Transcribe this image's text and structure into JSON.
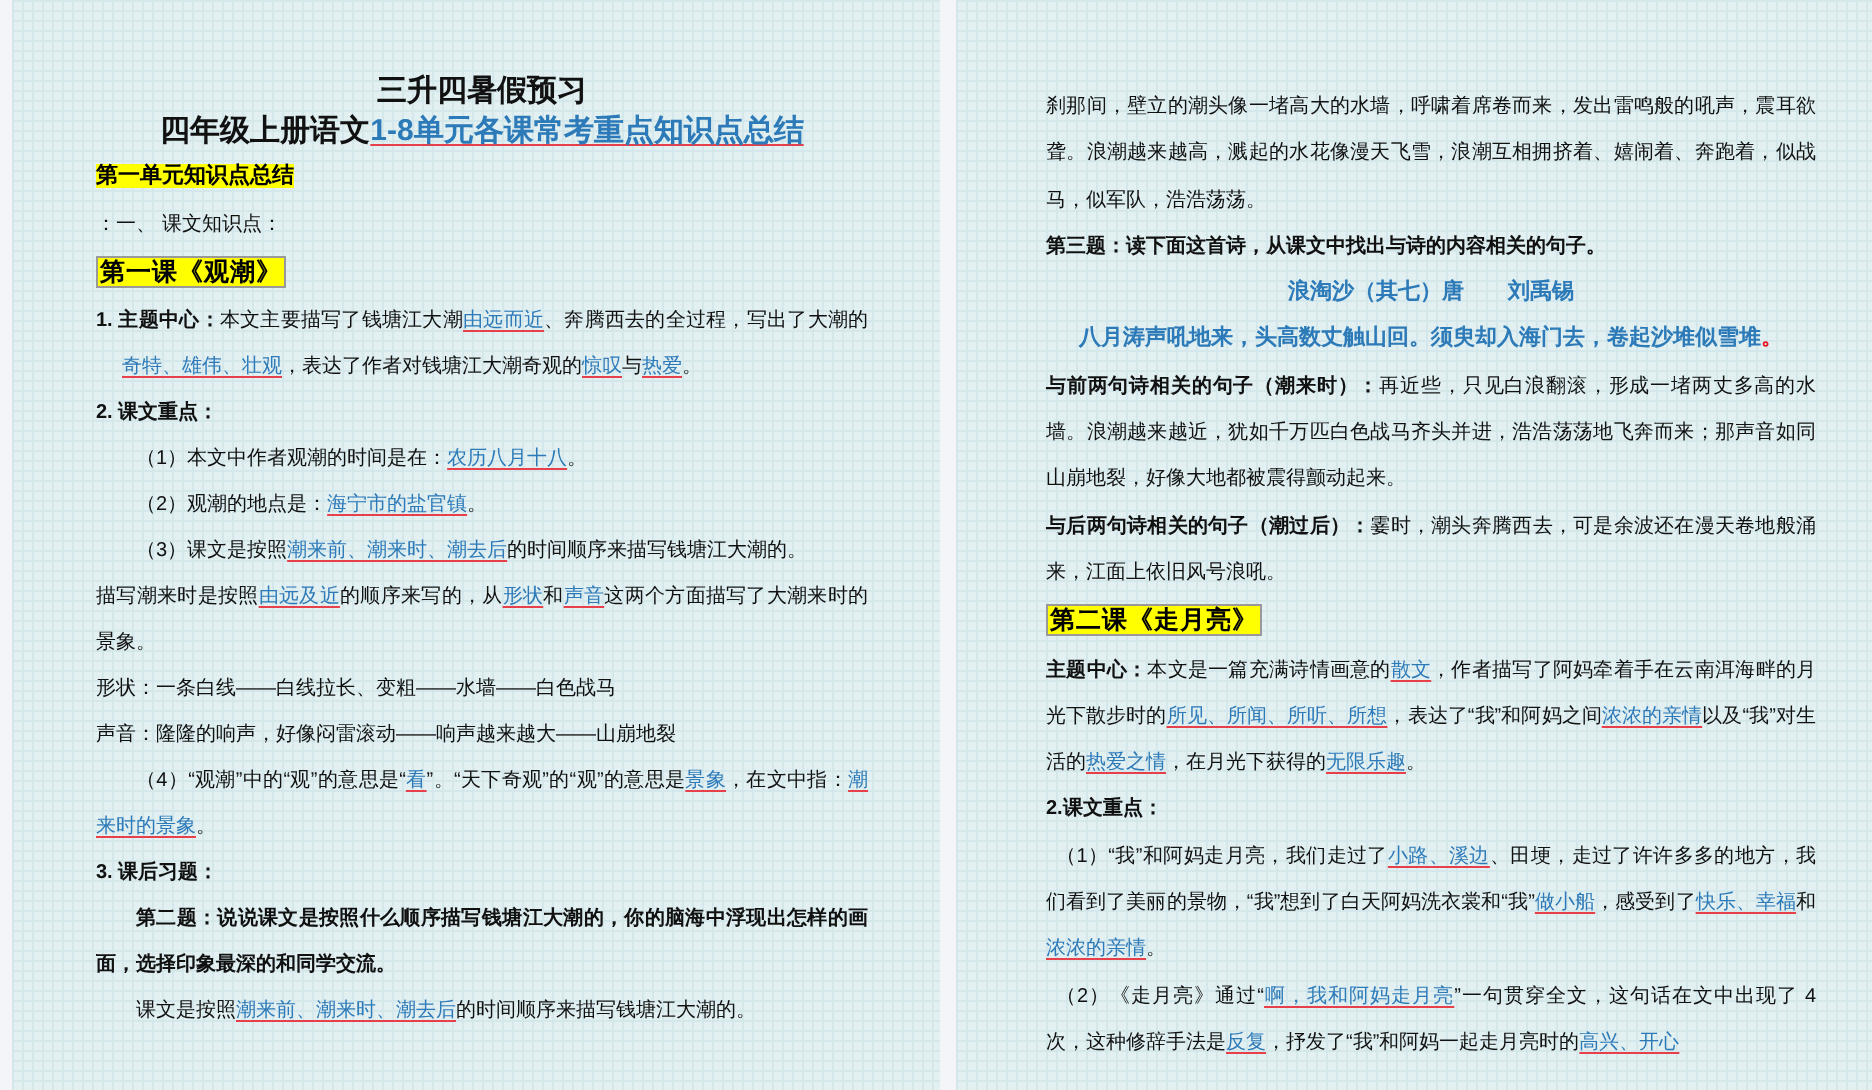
{
  "pages": [
    {
      "paragraphs": [
        {
          "kind": "title",
          "segments": [
            {
              "kind": "plain",
              "text": "三升四暑假预习"
            }
          ]
        },
        {
          "kind": "title",
          "segments": [
            {
              "kind": "plain",
              "text": "四年级上册语文"
            },
            {
              "kind": "key",
              "text": "1-8单元各课常考重点知识点总结"
            }
          ]
        },
        {
          "kind": "unit",
          "segments": [
            {
              "kind": "plain",
              "text": "第一单元知识点总结"
            }
          ]
        },
        {
          "kind": "plain",
          "segments": [
            {
              "kind": "plain",
              "text": "：一、  课文知识点："
            }
          ]
        },
        {
          "kind": "lesson",
          "segments": [
            {
              "kind": "plain",
              "text": "第一课《观潮》"
            }
          ]
        },
        {
          "kind": "hanging",
          "segments": [
            {
              "kind": "bold",
              "text": "1. 主题中心："
            },
            {
              "kind": "plain",
              "text": "本文主要描写了钱塘江大潮"
            },
            {
              "kind": "key",
              "text": "由远而近"
            },
            {
              "kind": "plain",
              "text": "、奔腾西去的全过程，写出了大潮的"
            },
            {
              "kind": "key",
              "text": "奇特、雄伟、壮观"
            },
            {
              "kind": "plain",
              "text": "，表达了作者对钱塘江大潮奇观的"
            },
            {
              "kind": "key",
              "text": "惊叹"
            },
            {
              "kind": "plain",
              "text": "与"
            },
            {
              "kind": "key",
              "text": "热爱"
            },
            {
              "kind": "plain",
              "text": "。"
            }
          ]
        },
        {
          "kind": "plain",
          "segments": [
            {
              "kind": "bold",
              "text": "2. 课文重点："
            }
          ]
        },
        {
          "kind": "indented",
          "segments": [
            {
              "kind": "plain",
              "text": "（1）本文中作者观潮的时间是在："
            },
            {
              "kind": "key",
              "text": "农历八月十八"
            },
            {
              "kind": "plain",
              "text": "。"
            }
          ]
        },
        {
          "kind": "indented",
          "segments": [
            {
              "kind": "plain",
              "text": "（2）观潮的地点是："
            },
            {
              "kind": "key",
              "text": "海宁市的盐官镇"
            },
            {
              "kind": "plain",
              "text": "。"
            }
          ]
        },
        {
          "kind": "indented",
          "segments": [
            {
              "kind": "plain",
              "text": "（3）课文是按照"
            },
            {
              "kind": "key",
              "text": "潮来前、潮来时、潮去后"
            },
            {
              "kind": "plain",
              "text": "的时间顺序来描写钱塘江大潮的。"
            }
          ]
        },
        {
          "kind": "plain",
          "segments": [
            {
              "kind": "plain",
              "text": "描写潮来时是按照"
            },
            {
              "kind": "key",
              "text": "由远及近"
            },
            {
              "kind": "plain",
              "text": "的顺序来写的，从"
            },
            {
              "kind": "key",
              "text": "形状"
            },
            {
              "kind": "plain",
              "text": "和"
            },
            {
              "kind": "key",
              "text": "声音"
            },
            {
              "kind": "plain",
              "text": "这两个方面描写了大潮来时的景象。"
            }
          ]
        },
        {
          "kind": "plain",
          "segments": [
            {
              "kind": "plain",
              "text": "形状：一条白线——白线拉长、变粗——水墙——白色战马"
            }
          ]
        },
        {
          "kind": "plain",
          "segments": [
            {
              "kind": "plain",
              "text": "声音：隆隆的响声，好像闷雷滚动——响声越来越大——山崩地裂"
            }
          ]
        },
        {
          "kind": "indented",
          "segments": [
            {
              "kind": "plain",
              "text": "（4）“观潮”中的“观”的意思是“"
            },
            {
              "kind": "key",
              "text": "看"
            },
            {
              "kind": "plain",
              "text": "”。“天下奇观”的“观”的意思是"
            },
            {
              "kind": "key",
              "text": "景象"
            },
            {
              "kind": "plain",
              "text": "，在文中指："
            },
            {
              "kind": "key",
              "text": "潮来时的景象"
            },
            {
              "kind": "plain",
              "text": "。"
            }
          ]
        },
        {
          "kind": "plain",
          "segments": [
            {
              "kind": "bold",
              "text": "3. 课后习题："
            }
          ]
        },
        {
          "kind": "indented",
          "segments": [
            {
              "kind": "bold",
              "text": "第二题：说说课文是按照什么顺序描写钱塘江大潮的，你的脑海中浮现出怎样的画面，选择印象最深的和同学交流。"
            }
          ]
        },
        {
          "kind": "indented",
          "segments": [
            {
              "kind": "plain",
              "text": "课文是按照"
            },
            {
              "kind": "key",
              "text": "潮来前、潮来时、潮去后"
            },
            {
              "kind": "plain",
              "text": "的时间顺序来描写钱塘江大潮的。"
            }
          ]
        }
      ]
    },
    {
      "paragraphs": [
        {
          "kind": "plain",
          "segments": [
            {
              "kind": "plain",
              "text": "刹那间，壁立的潮头像一堵高大的水墙，呼啸着席卷而来，发出雷鸣般的吼声，震耳欲聋。浪潮越来越高，溅起的水花像漫天飞雪，浪潮互相拥挤着、嬉闹着、奔跑着，似战马，似军队，浩浩荡荡。"
            }
          ]
        },
        {
          "kind": "plain",
          "segments": [
            {
              "kind": "bold",
              "text": "第三题：读下面这首诗，从课文中找出与诗的内容相关的句子。"
            }
          ]
        },
        {
          "kind": "poem",
          "segments": [
            {
              "kind": "plain",
              "text": "浪淘沙（其七）唐　　刘禹锡"
            }
          ]
        },
        {
          "kind": "poem",
          "segments": [
            {
              "kind": "plain",
              "text": "八月涛声吼地来，头高数丈触山回。须臾却入海门去，卷起沙堆似雪堆"
            },
            {
              "kind": "mark",
              "text": "。"
            }
          ]
        },
        {
          "kind": "plain",
          "segments": [
            {
              "kind": "bold",
              "text": "与前两句诗相关的句子（潮来时）："
            },
            {
              "kind": "plain",
              "text": "再近些，只见白浪翻滚，形成一堵两丈多高的水墙。浪潮越来越近，犹如千万匹白色战马齐头并进，浩浩荡荡地飞奔而来；那声音如同山崩地裂，好像大地都被震得颤动起来。"
            }
          ]
        },
        {
          "kind": "plain",
          "segments": [
            {
              "kind": "bold",
              "text": "与后两句诗相关的句子（潮过后）："
            },
            {
              "kind": "plain",
              "text": "霎时，潮头奔腾西去，可是余波还在漫天卷地般涌来，江面上依旧风号浪吼。"
            }
          ]
        },
        {
          "kind": "lesson",
          "segments": [
            {
              "kind": "plain",
              "text": "第二课《走月亮》"
            }
          ]
        },
        {
          "kind": "plain",
          "segments": [
            {
              "kind": "bold",
              "text": "主题中心："
            },
            {
              "kind": "plain",
              "text": "本文是一篇充满诗情画意的"
            },
            {
              "kind": "key",
              "text": "散文"
            },
            {
              "kind": "plain",
              "text": "，作者描写了阿妈牵着手在云南洱海畔的月光下散步时的"
            },
            {
              "kind": "key",
              "text": "所见、所闻、所听、所想"
            },
            {
              "kind": "plain",
              "text": "，表达了“我”和阿妈之间"
            },
            {
              "kind": "key",
              "text": "浓浓的亲情"
            },
            {
              "kind": "plain",
              "text": "以及“我”对生活的"
            },
            {
              "kind": "key",
              "text": "热爱之情"
            },
            {
              "kind": "plain",
              "text": "，在月光下获得的"
            },
            {
              "kind": "key",
              "text": "无限乐趣"
            },
            {
              "kind": "plain",
              "text": "。"
            }
          ]
        },
        {
          "kind": "plain",
          "segments": [
            {
              "kind": "bold",
              "text": "2.课文重点："
            }
          ]
        },
        {
          "kind": "nudged",
          "segments": [
            {
              "kind": "plain",
              "text": "（1）“我”和阿妈走月亮，我们走过了"
            },
            {
              "kind": "key",
              "text": "小路、溪边"
            },
            {
              "kind": "plain",
              "text": "、田埂，走过了许许多多的地方，我们看到了美丽的景物，“我”想到了白天阿妈洗衣裳和“我”"
            },
            {
              "kind": "key",
              "text": "做小船"
            },
            {
              "kind": "plain",
              "text": "，感受到了"
            },
            {
              "kind": "key",
              "text": "快乐、幸福"
            },
            {
              "kind": "plain",
              "text": "和"
            },
            {
              "kind": "key",
              "text": "浓浓的亲情"
            },
            {
              "kind": "plain",
              "text": "。"
            }
          ]
        },
        {
          "kind": "nudged",
          "segments": [
            {
              "kind": "plain",
              "text": "（2）《走月亮》通过“"
            },
            {
              "kind": "key",
              "text": "啊，我和阿妈走月亮"
            },
            {
              "kind": "plain",
              "text": "”一句贯穿全文，这句话在文中出现了 4 次，这种修辞手法是"
            },
            {
              "kind": "key",
              "text": "反复"
            },
            {
              "kind": "plain",
              "text": "，抒发了“我”和阿妈一起走月亮时的"
            },
            {
              "kind": "key",
              "text": "高兴、开心"
            }
          ]
        }
      ]
    }
  ]
}
